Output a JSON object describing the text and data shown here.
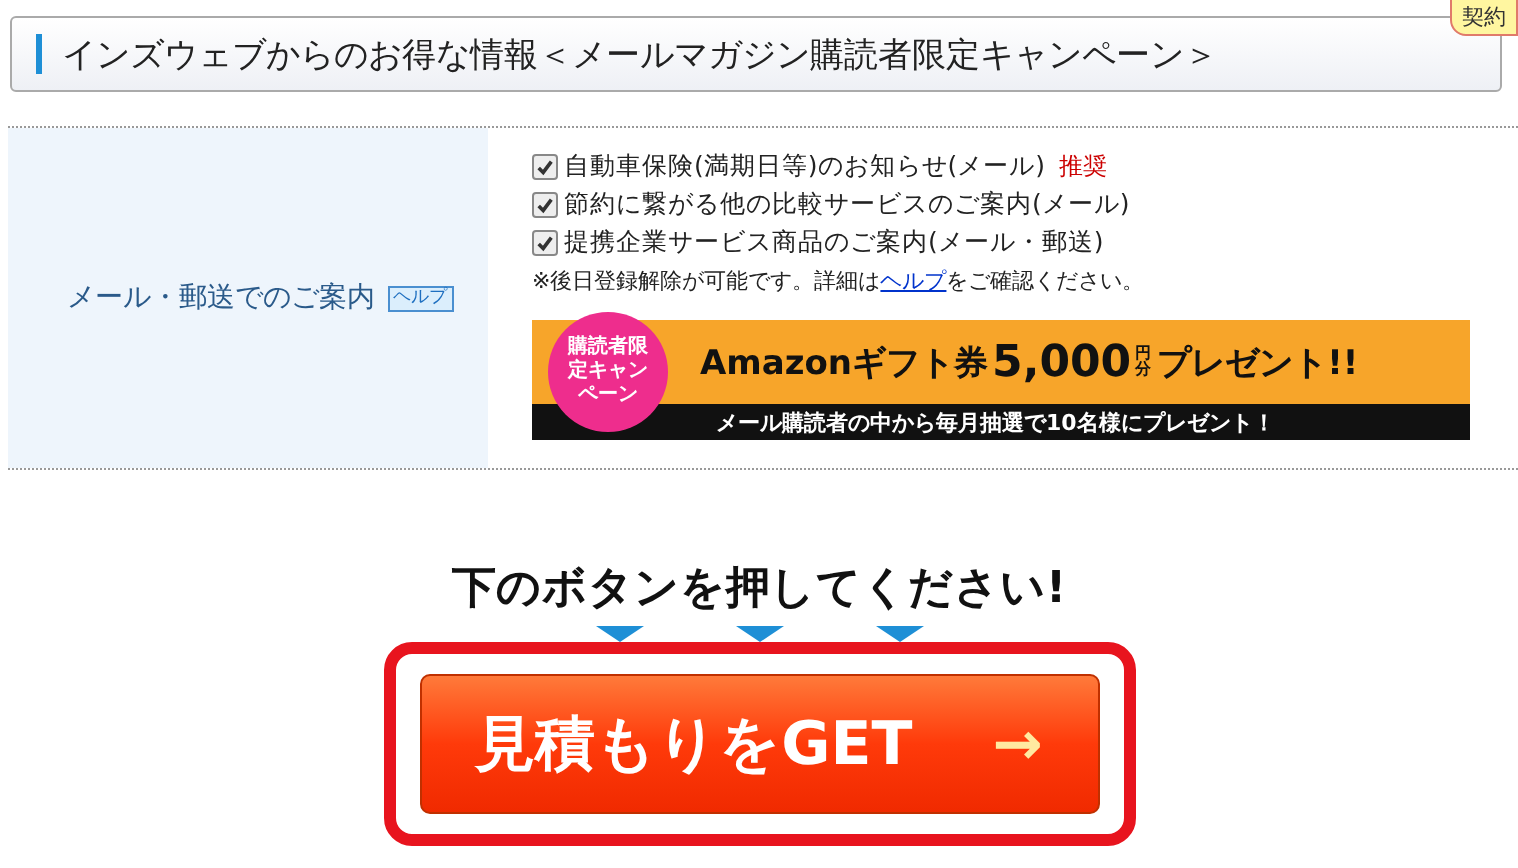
{
  "header": {
    "title": "インズウェブからのお得な情報＜メールマガジン購読者限定キャンペーン＞",
    "corner_tag": "契約"
  },
  "section": {
    "label": "メール・郵送でのご案内",
    "help_badge": "ヘルプ",
    "options": [
      {
        "label": "自動車保険(満期日等)のお知らせ(メール)",
        "checked": true,
        "badge": "推奨"
      },
      {
        "label": "節約に繋がる他の比較サービスのご案内(メール)",
        "checked": true
      },
      {
        "label": "提携企業サービス商品のご案内(メール・郵送)",
        "checked": true
      }
    ],
    "note_before": "※後日登録解除が可能です。詳細は",
    "note_link": "ヘルプ",
    "note_after": "をご確認ください。",
    "banner": {
      "circle": "購読者限定キャンペーン",
      "headline_1": "Amazonギフト券",
      "amount": "5,000",
      "unit": "円分",
      "headline_2": "プレゼント!!",
      "subline": "メール購読者の中から毎月抽選で10名様にプレゼント！"
    }
  },
  "cta": {
    "prompt": "下のボタンを押してください!",
    "button": "見積もりをGET",
    "arrow": "→"
  }
}
